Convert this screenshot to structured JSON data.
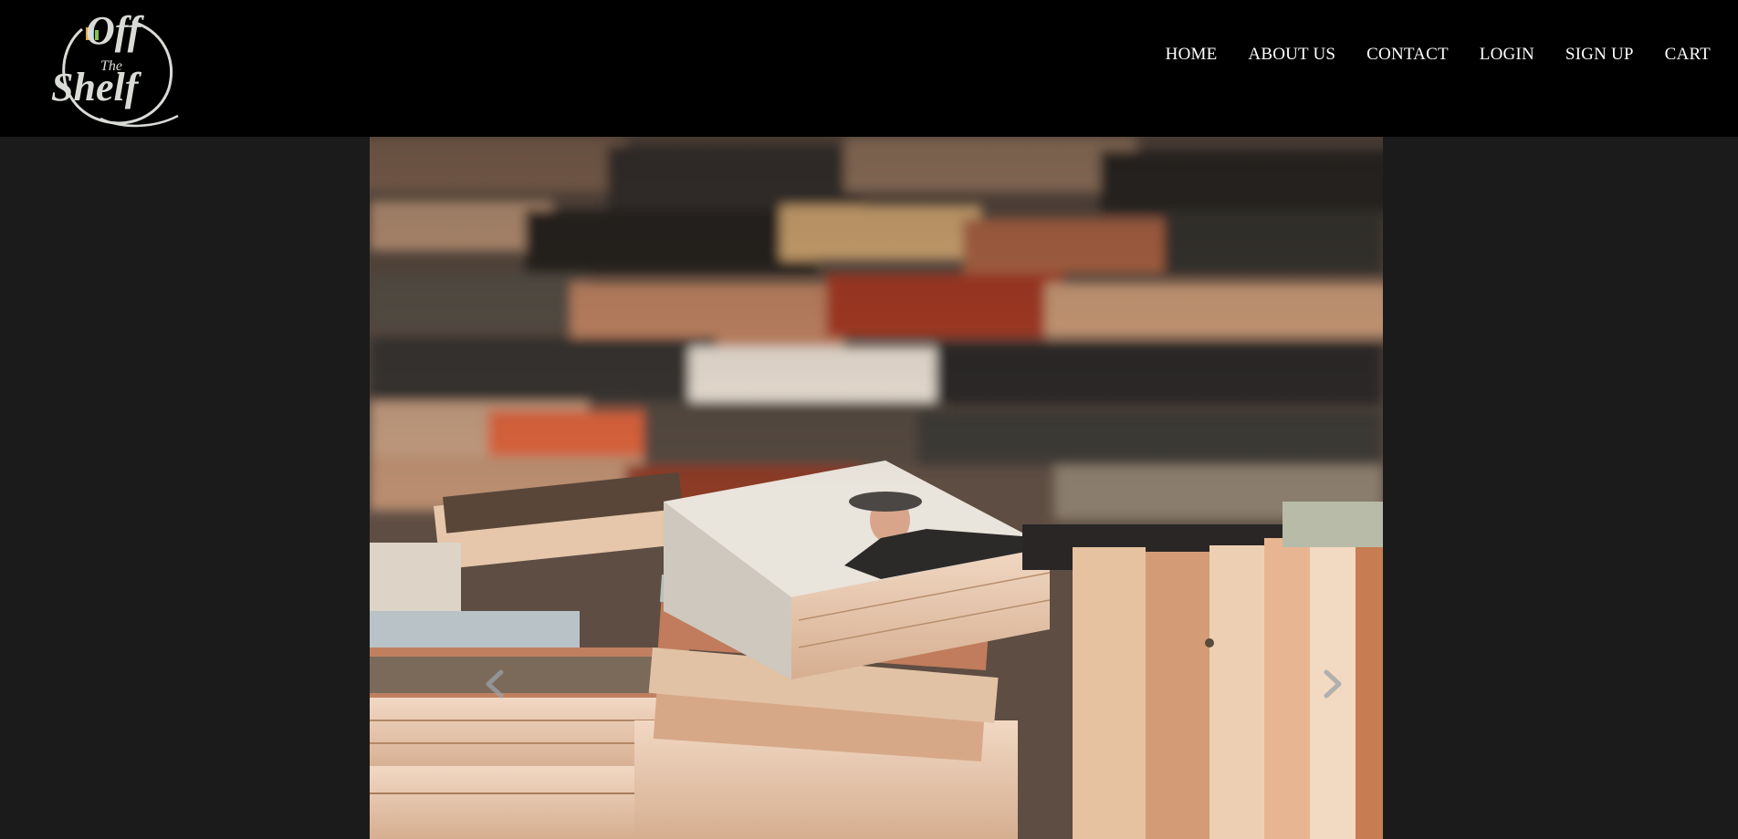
{
  "brand": {
    "logo_text": [
      "Off",
      "The",
      "Shelf"
    ]
  },
  "nav": [
    {
      "label": "HOME"
    },
    {
      "label": "ABOUT US"
    },
    {
      "label": "CONTACT"
    },
    {
      "label": "LOGIN"
    },
    {
      "label": "SIGN UP"
    },
    {
      "label": "CART"
    }
  ],
  "colors": {
    "header_bg": "#000000",
    "page_bg": "#1b1b1b",
    "nav_text": "#ffffff",
    "logo_color": "#d9dcd6"
  },
  "carousel": {
    "slide_description_icon": "books-photo",
    "prev_icon": "chevron-left-icon",
    "next_icon": "chevron-right-icon"
  }
}
